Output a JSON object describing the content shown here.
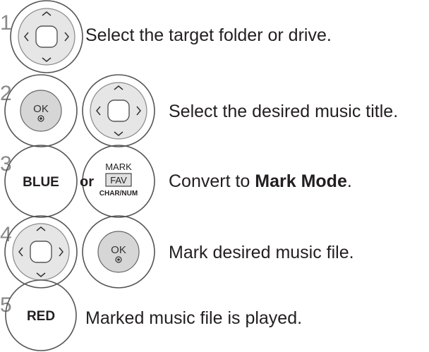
{
  "steps": [
    {
      "number": "1",
      "text": "Select the target folder or drive."
    },
    {
      "number": "2",
      "text": "Select the desired music title."
    },
    {
      "number": "3",
      "text_prefix": "Convert to ",
      "text_bold": "Mark Mode",
      "text_suffix": ".",
      "blue_label": "BLUE",
      "or_label": "or",
      "mark_label": "MARK",
      "fav_label": "FAV",
      "charnum_label": "CHAR/NUM"
    },
    {
      "number": "4",
      "text": "Mark desired music file."
    },
    {
      "number": "5",
      "text": "Marked music file is played.",
      "red_label": "RED"
    }
  ],
  "ok_label": "OK"
}
